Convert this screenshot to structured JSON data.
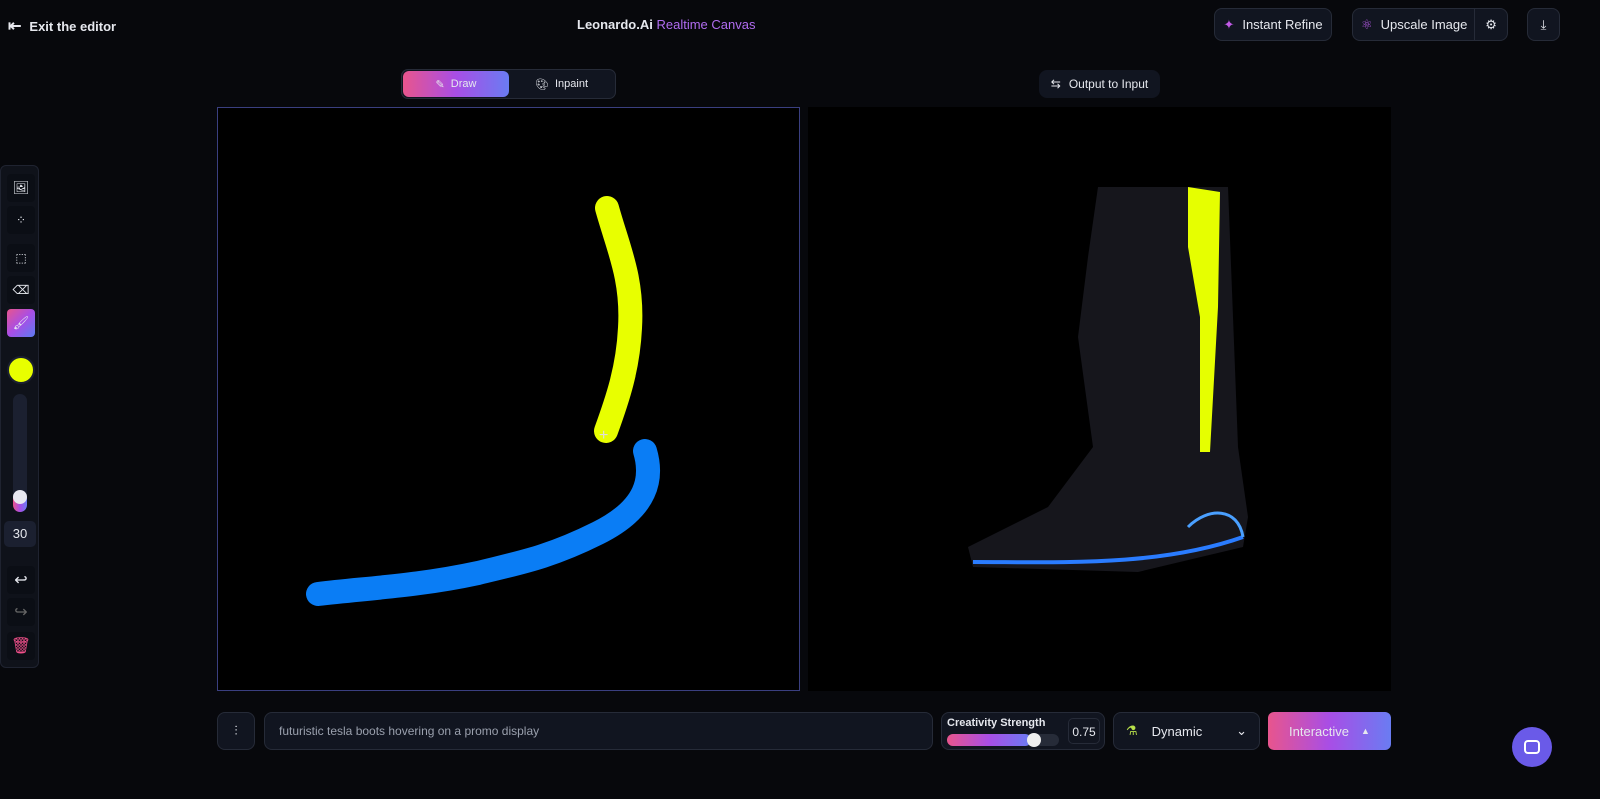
{
  "header": {
    "exit_label": "Exit the editor",
    "brand": "Leonardo.Ai",
    "title_accent": "Realtime Canvas",
    "instant_refine": "Instant Refine",
    "upscale": "Upscale Image"
  },
  "modes": {
    "draw": "Draw",
    "inpaint": "Inpaint"
  },
  "output_to_input": "Output to Input",
  "toolbar": {
    "brush_color": "#e8ff00",
    "brush_size": "30",
    "brush_size_fraction": 0.1
  },
  "prompt": {
    "value": "futuristic tesla boots hovering on a promo display"
  },
  "creativity": {
    "label": "Creativity Strength",
    "value": "0.75",
    "fraction": 0.75
  },
  "style": {
    "selected": "Dynamic"
  },
  "generate": {
    "label": "Interactive"
  },
  "colors": {
    "accent_start": "#e8558d",
    "accent_end": "#6a7cf2",
    "yellow_stroke": "#e8ff00",
    "blue_stroke": "#0a7df5"
  }
}
